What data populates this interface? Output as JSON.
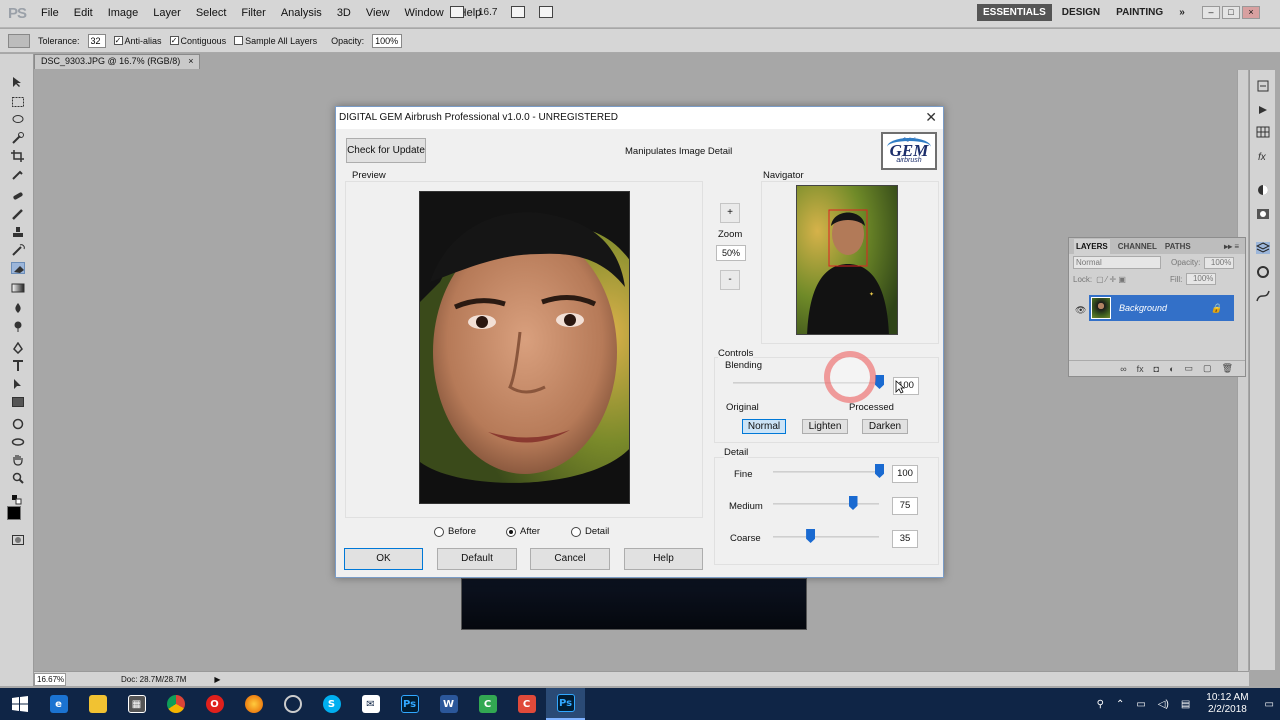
{
  "menubar": {
    "logo": "PS",
    "items": [
      "File",
      "Edit",
      "Image",
      "Layer",
      "Select",
      "Filter",
      "Analysis",
      "3D",
      "View",
      "Window",
      "Help"
    ],
    "zoom": "16.7",
    "workspaces": [
      "ESSENTIALS",
      "DESIGN",
      "PAINTING"
    ],
    "more": "»"
  },
  "options": {
    "tolerance_label": "Tolerance:",
    "tolerance_value": "32",
    "anti_alias": "Anti-alias",
    "contiguous": "Contiguous",
    "sample_all": "Sample All Layers",
    "opacity_label": "Opacity:",
    "opacity_value": "100%"
  },
  "document": {
    "tab_title": "DSC_9303.JPG @ 16.7% (RGB/8)",
    "close": "×"
  },
  "status": {
    "zoom": "16.67%",
    "doc": "Doc: 28.7M/28.7M"
  },
  "layers_panel": {
    "tabs": [
      "LAYERS",
      "CHANNEL",
      "PATHS"
    ],
    "blend_mode": "Normal",
    "opacity_label": "Opacity:",
    "opacity": "100%",
    "lock_label": "Lock:",
    "fill_label": "Fill:",
    "fill": "100%",
    "layer_name": "Background",
    "footer_icons": [
      "link-icon",
      "fx-icon",
      "mask-icon",
      "adjustment-icon",
      "folder-icon",
      "new-layer-icon",
      "trash-icon"
    ]
  },
  "dialog": {
    "title": "DIGITAL GEM Airbrush Professional v1.0.0 - UNREGISTERED",
    "close": "✕",
    "check_update": "Check for Update",
    "subtitle": "Manipulates Image Detail",
    "logo": {
      "top": "digital",
      "main": "GEM",
      "sub": "airbrush"
    },
    "preview_label": "Preview",
    "navigator_label": "Navigator",
    "zoom": {
      "plus": "+",
      "label": "Zoom",
      "value": "50%",
      "minus": "-"
    },
    "controls_label": "Controls",
    "blending": {
      "label": "Blending",
      "value": "100",
      "level": 1.0,
      "left": "Original",
      "right": "Processed",
      "modes": [
        "Normal",
        "Lighten",
        "Darken"
      ],
      "selected_mode": "Normal"
    },
    "detail": {
      "label": "Detail",
      "sliders": [
        {
          "name": "Fine",
          "value": "100",
          "level": 1.0
        },
        {
          "name": "Medium",
          "value": "75",
          "level": 0.75
        },
        {
          "name": "Coarse",
          "value": "35",
          "level": 0.35
        }
      ]
    },
    "view_options": [
      "Before",
      "After",
      "Detail"
    ],
    "selected_view": "After",
    "buttons": {
      "ok": "OK",
      "default": "Default",
      "cancel": "Cancel",
      "help": "Help"
    }
  },
  "taskbar": {
    "apps": [
      "start-icon",
      "edge-icon",
      "file-explorer-icon",
      "store-icon",
      "chrome-icon",
      "opera-icon",
      "firefox-icon",
      "settings-icon",
      "skype-icon",
      "mail-icon",
      "photoshop-icon",
      "word-icon",
      "camtasia-icon",
      "recorder-icon",
      "photoshop-active-icon"
    ],
    "time": "10:12 AM",
    "date": "2/2/2018"
  }
}
